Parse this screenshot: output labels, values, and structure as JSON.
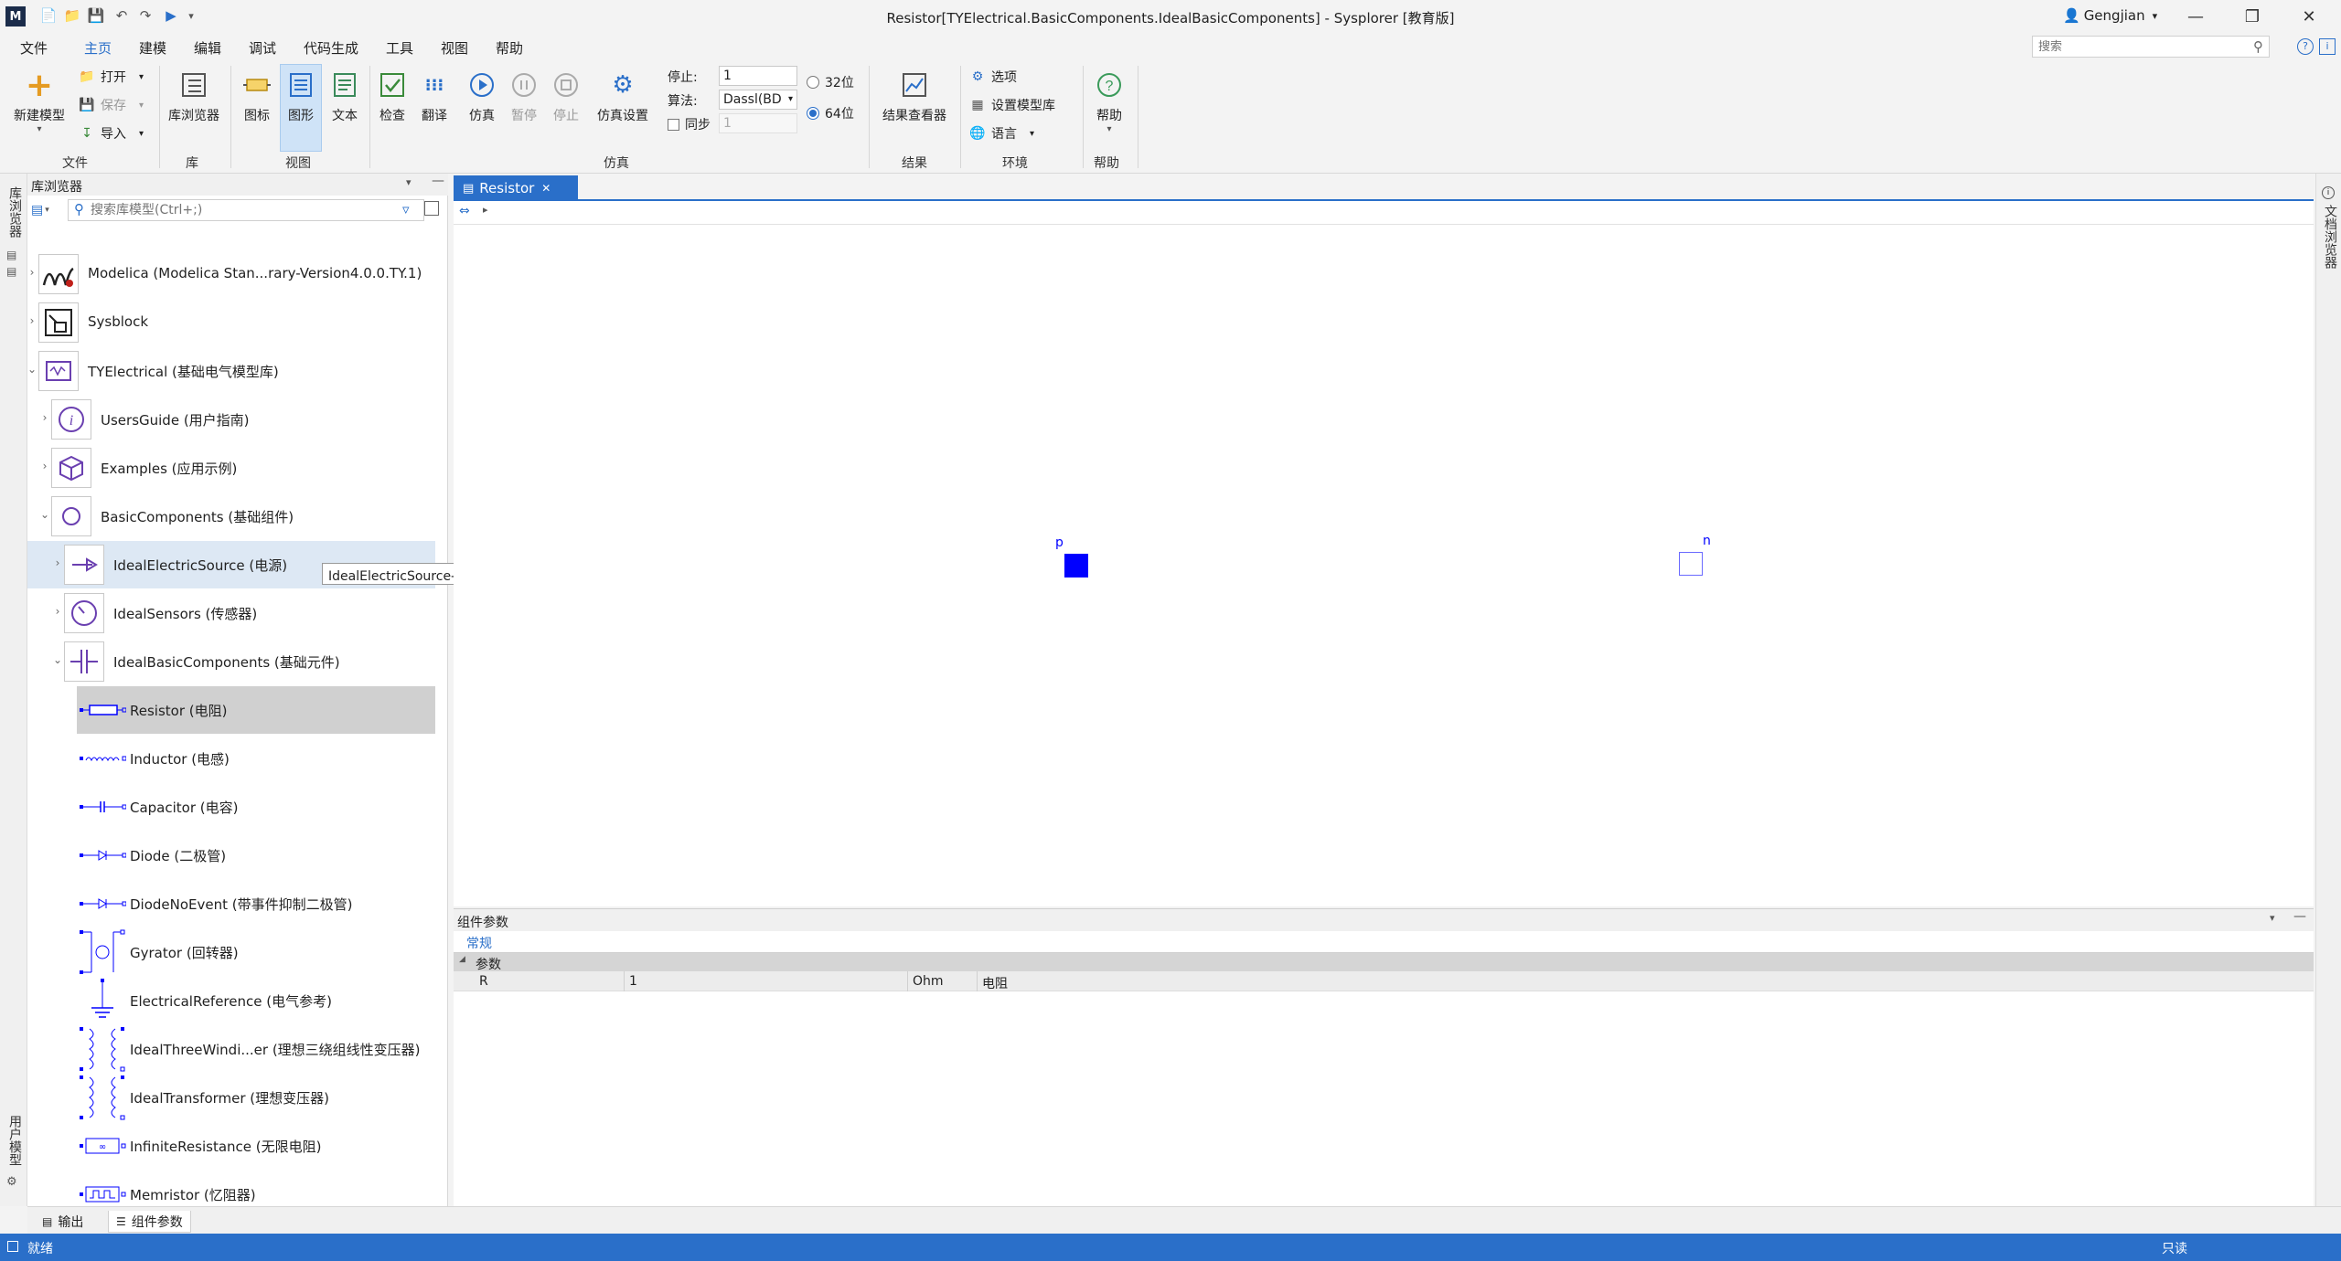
{
  "window": {
    "title": "Resistor[TYElectrical.BasicComponents.IdealBasicComponents] - Sysplorer [教育版]",
    "user": "Gengjian"
  },
  "menu": [
    "文件",
    "主页",
    "建模",
    "编辑",
    "调试",
    "代码生成",
    "工具",
    "视图",
    "帮助"
  ],
  "menu_active": "主页",
  "search": {
    "placeholder": "搜索"
  },
  "ribbon": {
    "new_model": "新建模型",
    "open": "打开",
    "save": "保存",
    "import": "导入",
    "group_file": "文件",
    "lib_browser": "库浏览器",
    "group_lib": "库",
    "icon": "图标",
    "diagram": "图形",
    "text": "文本",
    "group_view": "视图",
    "check": "检查",
    "translate": "翻译",
    "simulate": "仿真",
    "pause": "暂停",
    "stop": "停止",
    "sim_settings": "仿真设置",
    "stop_label": "停止:",
    "stop_value": "1",
    "algo_label": "算法:",
    "algo_value": "Dassl(BD",
    "sync_label": "同步",
    "sync_value": "1",
    "bit32": "32位",
    "bit64": "64位",
    "group_sim": "仿真",
    "result_viewer": "结果查看器",
    "group_result": "结果",
    "options": "选项",
    "set_lib": "设置模型库",
    "language": "语言",
    "group_env": "环境",
    "help": "帮助",
    "group_help": "帮助"
  },
  "left_strip": {
    "top": "库浏览器",
    "bottom": "用户模型"
  },
  "lib_browser": {
    "title": "库浏览器",
    "search_placeholder": "搜索库模型(Ctrl+;)",
    "items": [
      {
        "label": "Modelica (Modelica Stan...rary-Version4.0.0.TY.1)",
        "icon": "modelica-icon"
      },
      {
        "label": "Sysblock",
        "icon": "sysblock-icon"
      },
      {
        "label": "TYElectrical (基础电气模型库)",
        "icon": "tyelectrical-icon"
      },
      {
        "label": "UsersGuide (用户指南)",
        "icon": "info-icon"
      },
      {
        "label": "Examples (应用示例)",
        "icon": "cube-icon"
      },
      {
        "label": "BasicComponents (基础组件)",
        "icon": "circle-icon"
      },
      {
        "label": "IdealElectricSource (电源)",
        "icon": "source-arrow-icon"
      },
      {
        "label": "IdealSensors (传感器)",
        "icon": "gauge-icon"
      },
      {
        "label": "IdealBasicComponents (基础元件)",
        "icon": "capacitor-plates-icon"
      },
      {
        "label": "Resistor (电阻)",
        "icon": "resistor-icon"
      },
      {
        "label": "Inductor (电感)",
        "icon": "inductor-icon"
      },
      {
        "label": "Capacitor (电容)",
        "icon": "capacitor-icon"
      },
      {
        "label": "Diode (二极管)",
        "icon": "diode-icon"
      },
      {
        "label": "DiodeNoEvent (带事件抑制二极管)",
        "icon": "diode-icon"
      },
      {
        "label": "Gyrator (回转器)",
        "icon": "gyrator-icon"
      },
      {
        "label": "ElectricalReference (电气参考)",
        "icon": "ground-icon"
      },
      {
        "label": "IdealThreeWindi...er (理想三绕组线性变压器)",
        "icon": "transformer3-icon"
      },
      {
        "label": "IdealTransformer (理想变压器)",
        "icon": "transformer-icon"
      },
      {
        "label": "InfiniteResistance (无限电阻)",
        "icon": "infinite-resistance-icon"
      },
      {
        "label": "Memristor (忆阻器)",
        "icon": "memristor-icon"
      }
    ],
    "tooltip": "IdealElectricSource-电源"
  },
  "doc_tab": {
    "label": "Resistor"
  },
  "canvas": {
    "port_p": "p",
    "port_n": "n",
    "accent": "#0000ff"
  },
  "right_strip": {
    "label": "文档浏览器"
  },
  "params": {
    "title": "组件参数",
    "tab": "常规",
    "group": "参数",
    "rows": [
      {
        "name": "R",
        "value": "1",
        "unit": "Ohm",
        "desc": "电阻"
      }
    ]
  },
  "bottom_tabs": [
    "输出",
    "组件参数"
  ],
  "status": {
    "left": "就绪",
    "right": "只读"
  },
  "colors": {
    "accent": "#2a6fc9",
    "port": "#0000ff"
  }
}
